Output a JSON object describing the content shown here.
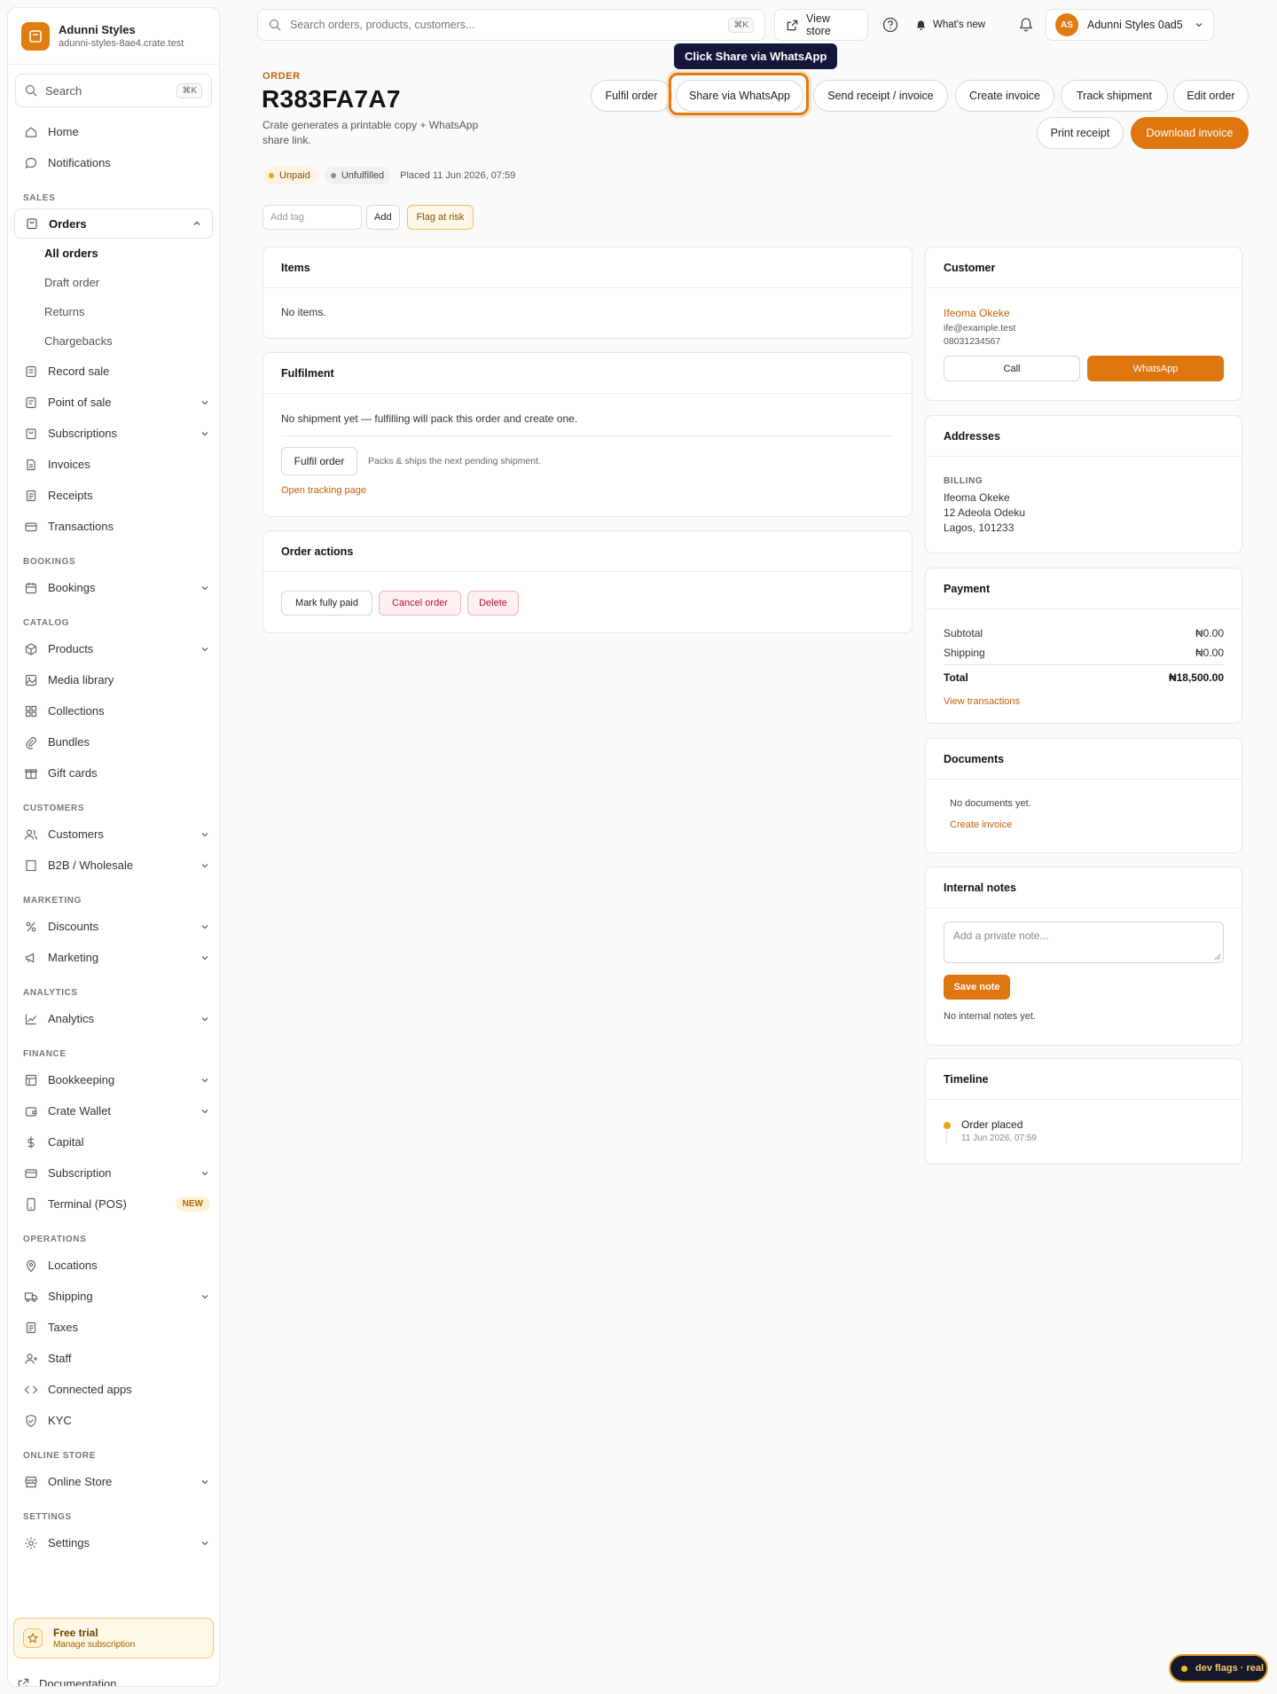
{
  "sidebar": {
    "brand": {
      "name": "Adunni Styles",
      "url": "adunni-styles-8ae4.crate.test"
    },
    "search": {
      "label": "Search",
      "shortcut": "⌘K"
    },
    "home": "Home",
    "notifications": "Notifications",
    "sections": {
      "sales": "SALES",
      "bookings": "BOOKINGS",
      "catalog": "CATALOG",
      "customers": "CUSTOMERS",
      "marketing": "MARKETING",
      "analytics": "ANALYTICS",
      "finance": "FINANCE",
      "operations": "OPERATIONS",
      "online_store": "ONLINE STORE",
      "settings": "SETTINGS"
    },
    "orders": {
      "label": "Orders",
      "sub": [
        "All orders",
        "Draft order",
        "Returns",
        "Chargebacks"
      ]
    },
    "items": {
      "record_sale": "Record sale",
      "point_of_sale": "Point of sale",
      "subscriptions": "Subscriptions",
      "invoices": "Invoices",
      "receipts": "Receipts",
      "transactions": "Transactions",
      "bookings": "Bookings",
      "products": "Products",
      "media_library": "Media library",
      "collections": "Collections",
      "bundles": "Bundles",
      "gift_cards": "Gift cards",
      "customers": "Customers",
      "b2b": "B2B / Wholesale",
      "discounts": "Discounts",
      "marketing": "Marketing",
      "analytics": "Analytics",
      "bookkeeping": "Bookkeeping",
      "crate_wallet": "Crate Wallet",
      "capital": "Capital",
      "subscription": "Subscription",
      "terminal": "Terminal (POS)",
      "terminal_badge": "NEW",
      "locations": "Locations",
      "shipping": "Shipping",
      "taxes": "Taxes",
      "staff": "Staff",
      "connected_apps": "Connected apps",
      "kyc": "KYC",
      "online_store": "Online Store",
      "settings": "Settings"
    },
    "trial": {
      "title": "Free trial",
      "subtitle": "Manage subscription"
    },
    "documentation": "Documentation"
  },
  "topbar": {
    "search_placeholder": "Search orders, products, customers...",
    "search_shortcut": "⌘K",
    "view_store": "View store",
    "whats_new": "What's new",
    "account": {
      "initials": "AS",
      "name": "Adunni Styles 0ad5"
    }
  },
  "tooltip": "Click Share via WhatsApp",
  "order": {
    "overline": "ORDER",
    "number": "R383FA7A7",
    "description": "Crate generates a printable copy + WhatsApp share link.",
    "status": {
      "payment": "Unpaid",
      "fulfilment": "Unfulfilled",
      "placed": "Placed 11 Jun 2026, 07:59"
    },
    "tag_placeholder": "Add tag",
    "add_label": "Add",
    "flag_label": "Flag at risk",
    "actions": {
      "fulfil": "Fulfil order",
      "share": "Share via WhatsApp",
      "send_receipt": "Send receipt / invoice",
      "create_invoice": "Create invoice",
      "track": "Track shipment",
      "edit": "Edit order",
      "print_receipt": "Print receipt",
      "download_invoice": "Download invoice"
    }
  },
  "items_card": {
    "title": "Items",
    "empty": "No items."
  },
  "fulfilment_card": {
    "title": "Fulfilment",
    "message": "No shipment yet — fulfilling will pack this order and create one.",
    "button": "Fulfil order",
    "hint": "Packs & ships the next pending shipment.",
    "tracking_link": "Open tracking page"
  },
  "order_actions_card": {
    "title": "Order actions",
    "mark_paid": "Mark fully paid",
    "cancel": "Cancel order",
    "delete": "Delete"
  },
  "customer_card": {
    "title": "Customer",
    "name": "Ifeoma Okeke",
    "email": "ife@example.test",
    "phone": "08031234567",
    "call": "Call",
    "whatsapp": "WhatsApp"
  },
  "addresses_card": {
    "title": "Addresses",
    "label": "BILLING",
    "lines": [
      "Ifeoma Okeke",
      "12 Adeola Odeku",
      "Lagos, 101233"
    ]
  },
  "payment_card": {
    "title": "Payment",
    "subtotal_label": "Subtotal",
    "subtotal": "₦0.00",
    "shipping_label": "Shipping",
    "shipping": "₦0.00",
    "total_label": "Total",
    "total": "₦18,500.00",
    "link": "View transactions"
  },
  "documents_card": {
    "title": "Documents",
    "empty": "No documents yet.",
    "link": "Create invoice"
  },
  "notes_card": {
    "title": "Internal notes",
    "placeholder": "Add a private note...",
    "save": "Save note",
    "empty": "No internal notes yet."
  },
  "timeline_card": {
    "title": "Timeline",
    "event": "Order placed",
    "time": "11 Jun 2026, 07:59"
  },
  "dev_flags": "dev flags · real",
  "colors": {
    "accent": "#de7610",
    "tooltip_bg": "#15173a",
    "danger": "#b5132b"
  }
}
